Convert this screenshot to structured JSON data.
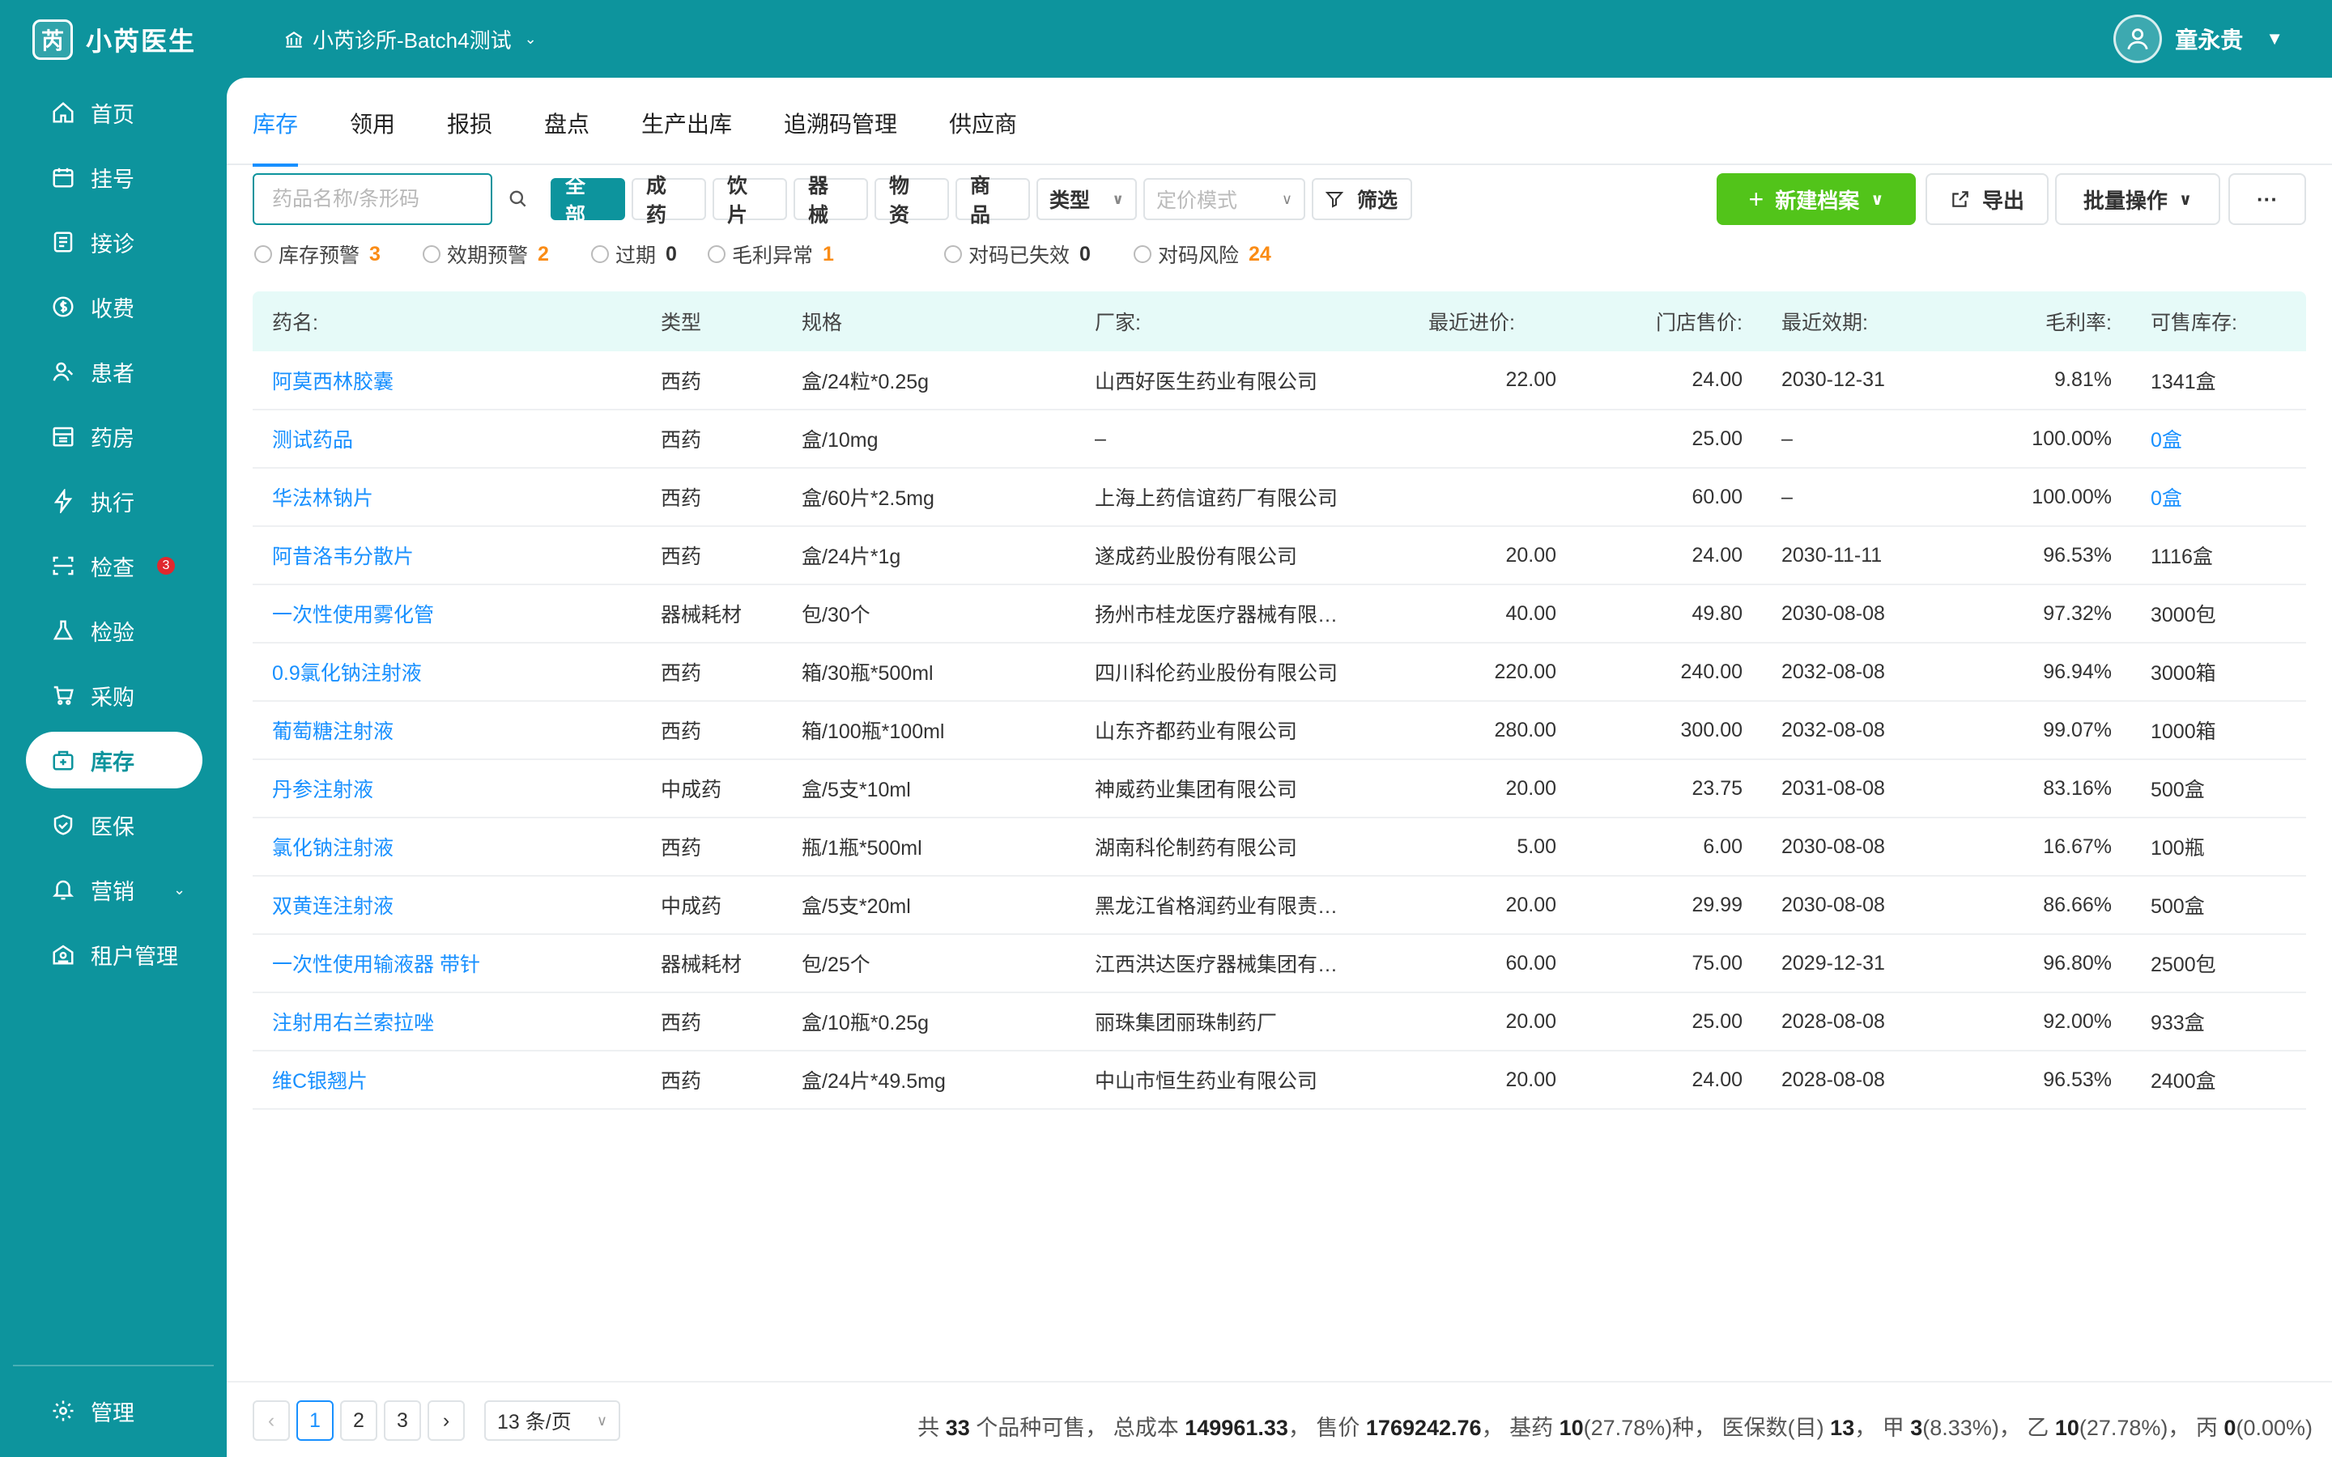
{
  "app": {
    "logo_glyph": "芮",
    "name": "小芮医生"
  },
  "clinic": {
    "name": "小芮诊所-Batch4测试"
  },
  "user": {
    "name": "童永贵"
  },
  "sidebar": {
    "items": [
      {
        "label": "首页",
        "icon": "home-icon"
      },
      {
        "label": "挂号",
        "icon": "calendar-icon"
      },
      {
        "label": "接诊",
        "icon": "clipboard-icon"
      },
      {
        "label": "收费",
        "icon": "dollar-icon"
      },
      {
        "label": "患者",
        "icon": "patient-icon"
      },
      {
        "label": "药房",
        "icon": "pharmacy-icon"
      },
      {
        "label": "执行",
        "icon": "lightning-icon"
      },
      {
        "label": "检查",
        "icon": "scan-icon",
        "badge": "3"
      },
      {
        "label": "检验",
        "icon": "flask-icon"
      },
      {
        "label": "采购",
        "icon": "cart-icon"
      },
      {
        "label": "库存",
        "icon": "inventory-icon",
        "active": true
      },
      {
        "label": "医保",
        "icon": "shield-icon"
      },
      {
        "label": "营销",
        "icon": "marketing-icon"
      },
      {
        "label": "租户管理",
        "icon": "building-icon"
      }
    ],
    "bottom": {
      "label": "管理",
      "icon": "gear-icon"
    }
  },
  "tabs": [
    "库存",
    "领用",
    "报损",
    "盘点",
    "生产出库",
    "追溯码管理",
    "供应商"
  ],
  "toolbar": {
    "search_placeholder": "药品名称/条形码",
    "chips": [
      "全部",
      "成药",
      "饮片",
      "器械",
      "物资",
      "商品"
    ],
    "type_dropdown": "类型",
    "pricing_dropdown": "定价模式",
    "filter_label": "筛选",
    "new_label": "新建档案",
    "export_label": "导出",
    "batch_label": "批量操作",
    "more_label": "···"
  },
  "filters": [
    {
      "label": "库存预警",
      "count": "3",
      "color": "orange"
    },
    {
      "label": "效期预警",
      "count": "2",
      "color": "orange"
    },
    {
      "label": "过期",
      "count": "0",
      "color": "dark"
    },
    {
      "label": "毛利异常",
      "count": "1",
      "color": "orange"
    },
    {
      "label": "对码已失效",
      "count": "0",
      "color": "dark"
    },
    {
      "label": "对码风险",
      "count": "24",
      "color": "orange"
    }
  ],
  "table": {
    "headers": [
      "药名:",
      "类型",
      "规格",
      "厂家:",
      "最近进价:",
      "门店售价:",
      "最近效期:",
      "毛利率:",
      "可售库存:"
    ],
    "rows": [
      [
        "阿莫西林胶囊",
        "西药",
        "盒/24粒*0.25g",
        "山西好医生药业有限公司",
        "22.00",
        "24.00",
        "2030-12-31",
        "9.81%",
        "1341盒"
      ],
      [
        "测试药品",
        "西药",
        "盒/10mg",
        "–",
        "",
        "25.00",
        "–",
        "100.00%",
        "0盒"
      ],
      [
        "华法林钠片",
        "西药",
        "盒/60片*2.5mg",
        "上海上药信谊药厂有限公司",
        "",
        "60.00",
        "–",
        "100.00%",
        "0盒"
      ],
      [
        "阿昔洛韦分散片",
        "西药",
        "盒/24片*1g",
        "遂成药业股份有限公司",
        "20.00",
        "24.00",
        "2030-11-11",
        "96.53%",
        "1116盒"
      ],
      [
        "一次性使用雾化管",
        "器械耗材",
        "包/30个",
        "扬州市桂龙医疗器械有限…",
        "40.00",
        "49.80",
        "2030-08-08",
        "97.32%",
        "3000包"
      ],
      [
        "0.9氯化钠注射液",
        "西药",
        "箱/30瓶*500ml",
        "四川科伦药业股份有限公司",
        "220.00",
        "240.00",
        "2032-08-08",
        "96.94%",
        "3000箱"
      ],
      [
        "葡萄糖注射液",
        "西药",
        "箱/100瓶*100ml",
        "山东齐都药业有限公司",
        "280.00",
        "300.00",
        "2032-08-08",
        "99.07%",
        "1000箱"
      ],
      [
        "丹参注射液",
        "中成药",
        "盒/5支*10ml",
        "神威药业集团有限公司",
        "20.00",
        "23.75",
        "2031-08-08",
        "83.16%",
        "500盒"
      ],
      [
        "氯化钠注射液",
        "西药",
        "瓶/1瓶*500ml",
        "湖南科伦制药有限公司",
        "5.00",
        "6.00",
        "2030-08-08",
        "16.67%",
        "100瓶"
      ],
      [
        "双黄连注射液",
        "中成药",
        "盒/5支*20ml",
        "黑龙江省格润药业有限责…",
        "20.00",
        "29.99",
        "2030-08-08",
        "86.66%",
        "500盒"
      ],
      [
        "一次性使用输液器 带针",
        "器械耗材",
        "包/25个",
        "江西洪达医疗器械集团有…",
        "60.00",
        "75.00",
        "2029-12-31",
        "96.80%",
        "2500包"
      ],
      [
        "注射用右兰索拉唑",
        "西药",
        "盒/10瓶*0.25g",
        "丽珠集团丽珠制药厂",
        "20.00",
        "25.00",
        "2028-08-08",
        "92.00%",
        "933盒"
      ],
      [
        "维C银翘片",
        "西药",
        "盒/24片*49.5mg",
        "中山市恒生药业有限公司",
        "20.00",
        "24.00",
        "2028-08-08",
        "96.53%",
        "2400盒"
      ]
    ]
  },
  "footer": {
    "pages": [
      "1",
      "2",
      "3"
    ],
    "page_size": "13 条/页",
    "summary": {
      "p1": "共 ",
      "species": "33",
      "p2": " 个品种可售， 总成本 ",
      "cost": "149961.33",
      "p3": "， 售价 ",
      "price": "1769242.76",
      "p4": "， 基药 ",
      "basic": "10",
      "p5": "(27.78%)种， 医保数(目) ",
      "ins": "13",
      "p6": "， 甲 ",
      "a": "3",
      "p7": "(8.33%)， 乙 ",
      "b": "10",
      "p8": "(27.78%)， 丙 ",
      "c": "0",
      "p9": "(0.00%)"
    }
  }
}
